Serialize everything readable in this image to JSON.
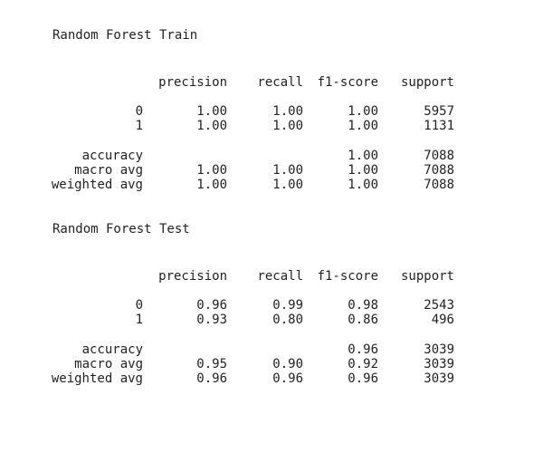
{
  "reports": [
    {
      "title": "Random Forest Train",
      "headers": {
        "precision": "precision",
        "recall": "recall",
        "f1": "f1-score",
        "support": "support"
      },
      "classes": [
        {
          "label": "0",
          "precision": "1.00",
          "recall": "1.00",
          "f1": "1.00",
          "support": "5957"
        },
        {
          "label": "1",
          "precision": "1.00",
          "recall": "1.00",
          "f1": "1.00",
          "support": "1131"
        }
      ],
      "summary": [
        {
          "label": "accuracy",
          "precision": "",
          "recall": "",
          "f1": "1.00",
          "support": "7088"
        },
        {
          "label": "macro avg",
          "precision": "1.00",
          "recall": "1.00",
          "f1": "1.00",
          "support": "7088"
        },
        {
          "label": "weighted avg",
          "precision": "1.00",
          "recall": "1.00",
          "f1": "1.00",
          "support": "7088"
        }
      ]
    },
    {
      "title": "Random Forest Test",
      "headers": {
        "precision": "precision",
        "recall": "recall",
        "f1": "f1-score",
        "support": "support"
      },
      "classes": [
        {
          "label": "0",
          "precision": "0.96",
          "recall": "0.99",
          "f1": "0.98",
          "support": "2543"
        },
        {
          "label": "1",
          "precision": "0.93",
          "recall": "0.80",
          "f1": "0.86",
          "support": "496"
        }
      ],
      "summary": [
        {
          "label": "accuracy",
          "precision": "",
          "recall": "",
          "f1": "0.96",
          "support": "3039"
        },
        {
          "label": "macro avg",
          "precision": "0.95",
          "recall": "0.90",
          "f1": "0.92",
          "support": "3039"
        },
        {
          "label": "weighted avg",
          "precision": "0.96",
          "recall": "0.96",
          "f1": "0.96",
          "support": "3039"
        }
      ]
    }
  ]
}
